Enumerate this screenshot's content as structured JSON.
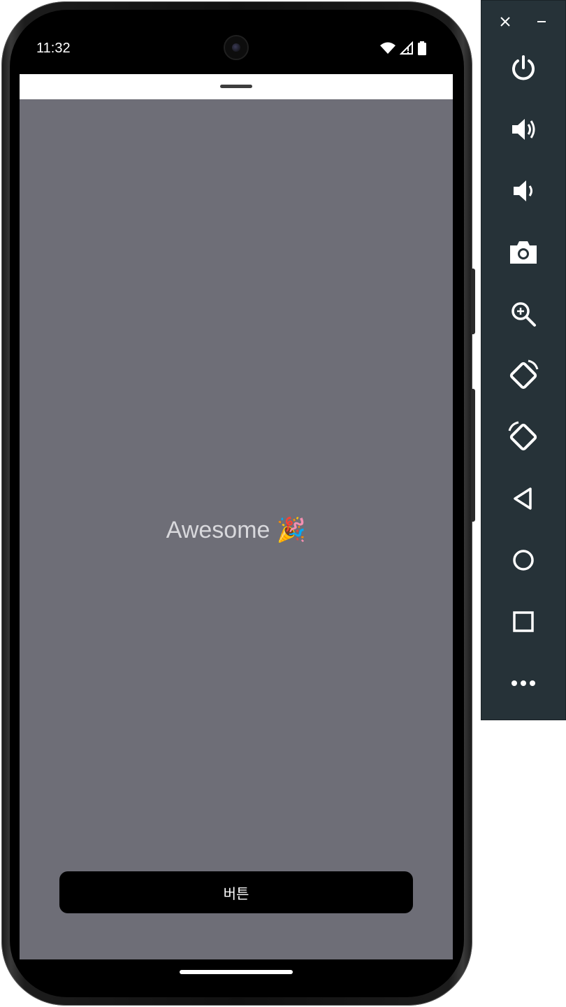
{
  "status_bar": {
    "time": "11:32",
    "icons": [
      "wifi-icon",
      "signal-icon",
      "battery-icon"
    ]
  },
  "screen": {
    "headline": "Awesome 🎉",
    "button_label": "버튼",
    "background_color": "#6e6e77",
    "button_color": "#000000"
  },
  "emulator_toolbar": {
    "window_controls": [
      "close-icon",
      "minimize-icon"
    ],
    "items": [
      "power-icon",
      "volume-up-icon",
      "volume-down-icon",
      "camera-icon",
      "zoom-icon",
      "rotate-left-icon",
      "rotate-right-icon",
      "back-icon",
      "home-icon",
      "overview-icon",
      "more-icon"
    ],
    "background_color": "#263238"
  }
}
